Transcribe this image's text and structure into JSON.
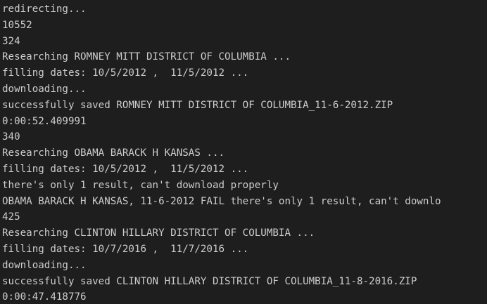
{
  "colors": {
    "background": "#1e1e1e",
    "text": "#cccccc"
  },
  "terminal": {
    "lines": [
      "redirecting...",
      "10552",
      "324",
      "Researching ROMNEY MITT DISTRICT OF COLUMBIA ...",
      "filling dates: 10/5/2012 ,  11/5/2012 ...",
      "downloading...",
      "successfully saved ROMNEY MITT DISTRICT OF COLUMBIA_11-6-2012.ZIP",
      "0:00:52.409991",
      "340",
      "Researching OBAMA BARACK H KANSAS ...",
      "filling dates: 10/5/2012 ,  11/5/2012 ...",
      "there's only 1 result, can't download properly",
      "OBAMA BARACK H KANSAS, 11-6-2012 FAIL there's only 1 result, can't downlo",
      "425",
      "Researching CLINTON HILLARY DISTRICT OF COLUMBIA ...",
      "filling dates: 10/7/2016 ,  11/7/2016 ...",
      "downloading...",
      "successfully saved CLINTON HILLARY DISTRICT OF COLUMBIA_11-8-2016.ZIP",
      "0:00:47.418776"
    ]
  }
}
